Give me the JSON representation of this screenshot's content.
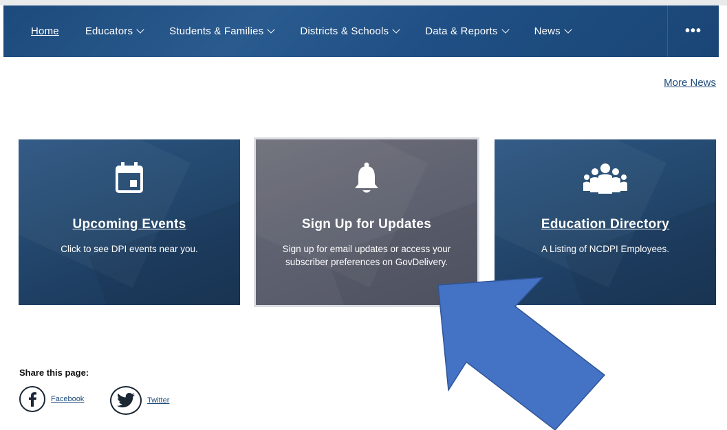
{
  "nav": {
    "items": [
      {
        "label": "Home",
        "chevron": false
      },
      {
        "label": "Educators",
        "chevron": true
      },
      {
        "label": "Students & Families",
        "chevron": true
      },
      {
        "label": "Districts & Schools",
        "chevron": true
      },
      {
        "label": "Data & Reports",
        "chevron": true
      },
      {
        "label": "News",
        "chevron": true
      }
    ],
    "more_label": "•••"
  },
  "more_news_label": "More News",
  "cards": [
    {
      "title": "Upcoming Events",
      "description": "Click to see DPI events near you.",
      "icon": "calendar-icon"
    },
    {
      "title": "Sign Up for Updates",
      "description": "Sign up for email updates or access your subscriber preferences on GovDelivery.",
      "icon": "bell-icon"
    },
    {
      "title": "Education Directory",
      "description": "A Listing of NCDPI Employees.",
      "icon": "people-group-icon"
    }
  ],
  "share": {
    "label": "Share this page:",
    "facebook": "Facebook",
    "twitter": "Twitter"
  },
  "colors": {
    "nav_blue": "#1f4f84",
    "card_blue": "#24496f",
    "card_gray": "#5f6270",
    "annotation_arrow": "#4472c4"
  }
}
